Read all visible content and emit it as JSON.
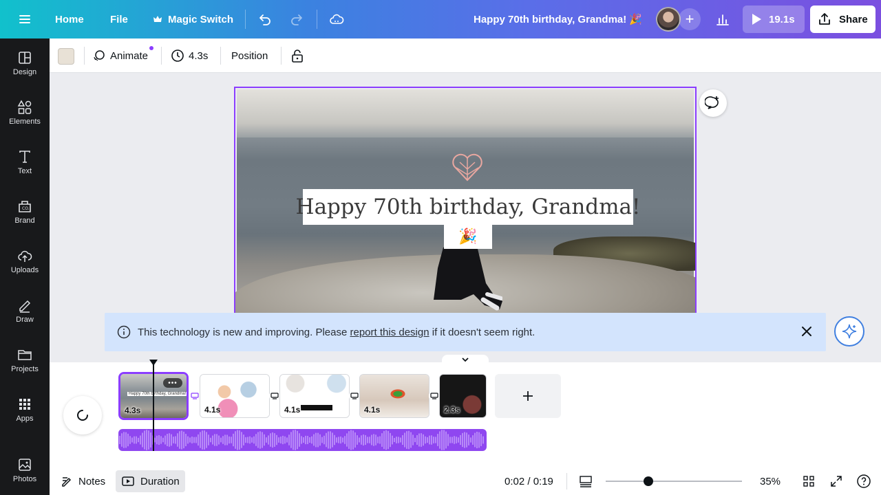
{
  "topbar": {
    "home": "Home",
    "file": "File",
    "magic_switch": "Magic Switch",
    "doc_title": "Happy 70th birthday, Grandma! 🎉",
    "play_duration": "19.1s",
    "share": "Share"
  },
  "sidebar": {
    "items": [
      {
        "label": "Design",
        "icon": "design-icon"
      },
      {
        "label": "Elements",
        "icon": "elements-icon"
      },
      {
        "label": "Text",
        "icon": "text-icon"
      },
      {
        "label": "Brand",
        "icon": "brand-icon"
      },
      {
        "label": "Uploads",
        "icon": "uploads-icon"
      },
      {
        "label": "Draw",
        "icon": "draw-icon"
      },
      {
        "label": "Projects",
        "icon": "projects-icon"
      },
      {
        "label": "Apps",
        "icon": "apps-icon"
      },
      {
        "label": "Photos",
        "icon": "photos-icon"
      }
    ]
  },
  "toolbar": {
    "swatch_color": "#e8e1d6",
    "animate": "Animate",
    "duration": "4.3s",
    "position": "Position"
  },
  "canvas": {
    "title": "Happy 70th birthday, Grandma!",
    "emoji": "🎉"
  },
  "notice": {
    "before": "This technology is new and improving. Please ",
    "link": "report this design",
    "after": " if it doesn't seem right."
  },
  "timeline": {
    "clips": [
      {
        "duration": "4.3s",
        "caption": "Happy 70th birthday, Grandma!"
      },
      {
        "duration": "4.1s"
      },
      {
        "duration": "4.1s"
      },
      {
        "duration": "4.1s"
      },
      {
        "duration": "2.3s"
      }
    ]
  },
  "footer": {
    "notes": "Notes",
    "duration": "Duration",
    "time": "0:02 / 0:19",
    "zoom": "35%"
  },
  "colors": {
    "accent": "#8b3dff",
    "audio": "#8f47f0",
    "sidebar": "#18191b",
    "notice_bg": "#d3e4fd"
  }
}
